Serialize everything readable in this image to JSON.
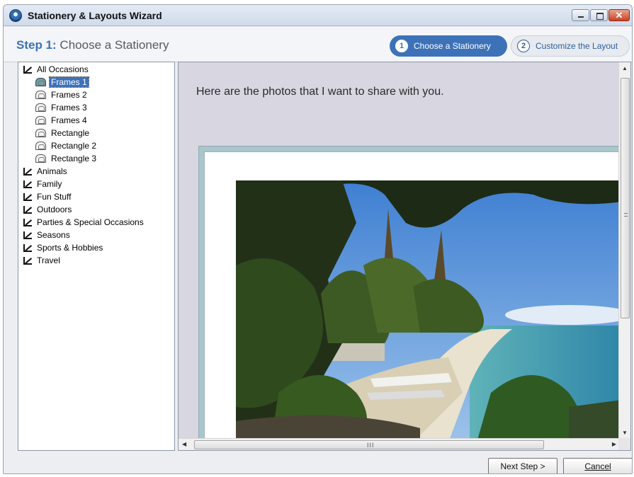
{
  "window": {
    "title": "Stationery & Layouts Wizard"
  },
  "step_header": {
    "step_prefix": "Step 1:",
    "step_title": "Choose a Stationery",
    "steps": [
      {
        "number": "1",
        "label": "Choose a Stationery",
        "active": true
      },
      {
        "number": "2",
        "label": "Customize the Layout",
        "active": false
      }
    ]
  },
  "tree": {
    "items": [
      {
        "label": "All Occasions",
        "type": "category",
        "icon": "category-icon"
      },
      {
        "label": "Frames 1",
        "type": "stationery",
        "icon": "stationery-icon",
        "selected": true
      },
      {
        "label": "Frames 2",
        "type": "stationery",
        "icon": "stationery-icon"
      },
      {
        "label": "Frames 3",
        "type": "stationery",
        "icon": "stationery-icon"
      },
      {
        "label": "Frames 4",
        "type": "stationery",
        "icon": "stationery-icon"
      },
      {
        "label": "Rectangle",
        "type": "stationery",
        "icon": "stationery-icon"
      },
      {
        "label": "Rectangle 2",
        "type": "stationery",
        "icon": "stationery-icon"
      },
      {
        "label": "Rectangle 3",
        "type": "stationery",
        "icon": "stationery-icon"
      },
      {
        "label": "Animals",
        "type": "category",
        "icon": "category-icon"
      },
      {
        "label": "Family",
        "type": "category",
        "icon": "category-icon"
      },
      {
        "label": "Fun Stuff",
        "type": "category",
        "icon": "category-icon"
      },
      {
        "label": "Outdoors",
        "type": "category",
        "icon": "category-icon"
      },
      {
        "label": "Parties & Special Occasions",
        "type": "category",
        "icon": "category-icon"
      },
      {
        "label": "Seasons",
        "type": "category",
        "icon": "category-icon"
      },
      {
        "label": "Sports & Hobbies",
        "type": "category",
        "icon": "category-icon"
      },
      {
        "label": "Travel",
        "type": "category",
        "icon": "category-icon"
      }
    ]
  },
  "preview": {
    "message": "Here are the photos that I want to share with you.",
    "scroll_grip": "III"
  },
  "buttons": {
    "next": "Next Step >",
    "cancel": "Cancel"
  },
  "colors": {
    "accent": "#3d72b8",
    "preview_background": "#d8d6e1",
    "frame_border": "#a9c6cb"
  }
}
